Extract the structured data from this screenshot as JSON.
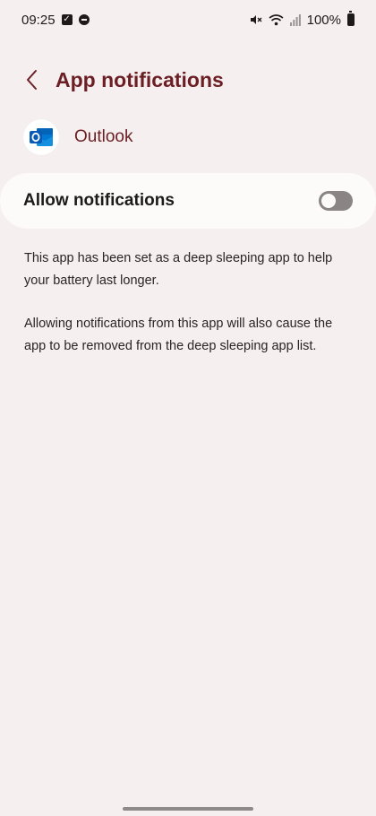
{
  "status_bar": {
    "time": "09:25",
    "battery": "100%"
  },
  "header": {
    "title": "App notifications"
  },
  "app": {
    "name": "Outlook",
    "icon": "outlook-icon"
  },
  "allow_notifications": {
    "label": "Allow notifications",
    "enabled": false
  },
  "description": {
    "paragraph1": "This app has been set as a deep sleeping app to help your battery last longer.",
    "paragraph2": "Allowing notifications from this app will also cause the app to be removed from the deep sleeping app list."
  },
  "colors": {
    "background": "#f6efef",
    "accent": "#6b1f24",
    "card": "#fdfafa",
    "toggle_off": "#8a8484",
    "outlook_blue": "#0a64c8"
  }
}
